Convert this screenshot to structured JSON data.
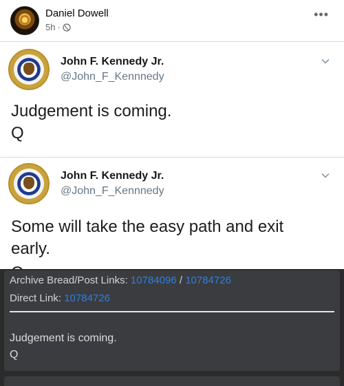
{
  "post": {
    "author": "Daniel Dowell",
    "time": "5h",
    "separator": "·",
    "more": "•••"
  },
  "tweets": [
    {
      "name": "John F. Kennedy Jr.",
      "handle": "@John_F_Kennnedy",
      "lines": [
        "Judgement is coming.",
        "Q"
      ]
    },
    {
      "name": "John F. Kennedy Jr.",
      "handle": "@John_F_Kennnedy",
      "lines": [
        "Some will take the easy path and exit",
        "early."
      ],
      "cut_line": "Q"
    }
  ],
  "board": {
    "archive_label": "Archive Bread/Post Links:",
    "archive_link_1": "10784096",
    "archive_sep": "/",
    "archive_link_2": "10784726",
    "direct_label": "Direct Link:",
    "direct_link": "10784726",
    "message_lines": [
      "Judgement is coming.",
      "Q"
    ]
  },
  "colors": {
    "link": "#2d7fe0",
    "board_bg": "#2b2b2b",
    "card_bg": "#3b3c3f"
  }
}
